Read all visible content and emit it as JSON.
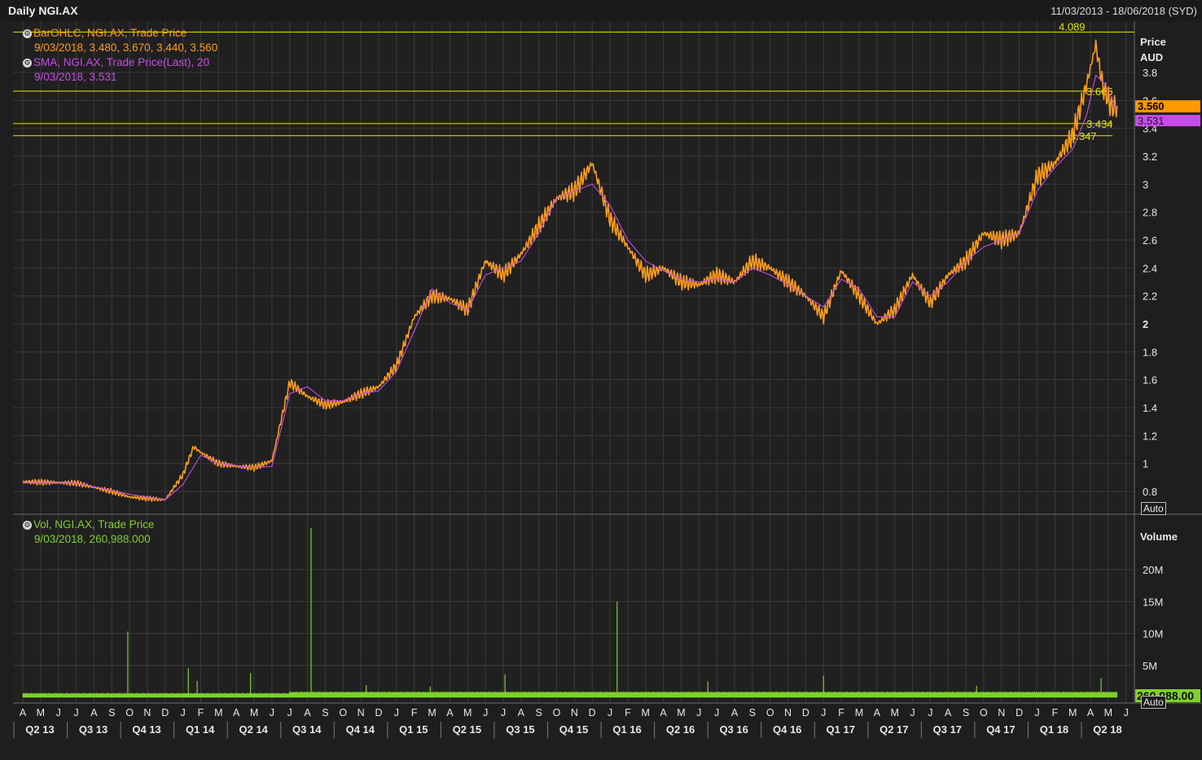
{
  "header": {
    "title": "Daily NGI.AX",
    "date_range": "11/03/2013 - 18/06/2018 (SYD)"
  },
  "legend": {
    "ohlc_label": "BarOHLC, NGI.AX, Trade Price",
    "ohlc_values": "9/03/2018, 3.480, 3.670, 3.440, 3.560",
    "sma_label": "SMA, NGI.AX, Trade Price(Last),  20",
    "sma_values": "9/03/2018, 3.531",
    "vol_label": "Vol, NGI.AX, Trade Price",
    "vol_values": "9/03/2018, 260,988.000"
  },
  "axes": {
    "price_title": "Price",
    "price_unit": "AUD",
    "volume_title": "Volume",
    "auto_label": "Auto"
  },
  "colors": {
    "price": "#ff9d1a",
    "sma": "#c84ce8",
    "volume": "#7fd12a",
    "hline": "#e6e600",
    "grid": "#3a3a3a"
  },
  "chart_data": [
    {
      "type": "line",
      "ylim": [
        0.7,
        4.1
      ],
      "y_ticks": [
        0.8,
        1,
        1.2,
        1.4,
        1.6,
        1.8,
        2,
        2.2,
        2.4,
        2.6,
        2.8,
        3,
        3.2,
        3.4,
        3.6,
        3.8
      ],
      "months": [
        "A",
        "M",
        "J",
        "J",
        "A",
        "S",
        "O",
        "N",
        "D",
        "J",
        "F",
        "M",
        "A",
        "M",
        "J",
        "J",
        "A",
        "S",
        "O",
        "N",
        "D",
        "J",
        "F",
        "M",
        "A",
        "M",
        "J",
        "J",
        "A",
        "S",
        "O",
        "N",
        "D",
        "J",
        "F",
        "M",
        "A",
        "M",
        "J",
        "J",
        "A",
        "S",
        "O",
        "N",
        "D",
        "J",
        "F",
        "M",
        "A",
        "M",
        "J",
        "J",
        "A",
        "S",
        "O",
        "N",
        "D",
        "J",
        "F",
        "M",
        "A",
        "M",
        "J"
      ],
      "quarters": [
        "Q2 13",
        "Q3 13",
        "Q4 13",
        "Q1 14",
        "Q2 14",
        "Q3 14",
        "Q4 14",
        "Q1 15",
        "Q2 15",
        "Q3 15",
        "Q4 15",
        "Q1 16",
        "Q2 16",
        "Q3 16",
        "Q4 16",
        "Q1 17",
        "Q2 17",
        "Q3 17",
        "Q4 17",
        "Q1 18",
        "Q2 18"
      ],
      "series": [
        {
          "values": [
            [
              0,
              0.87
            ],
            [
              3,
              0.86
            ],
            [
              5,
              0.8
            ],
            [
              6,
              0.76
            ],
            [
              7,
              0.75
            ],
            [
              8,
              0.74
            ],
            [
              9,
              0.92
            ],
            [
              9.6,
              1.12
            ],
            [
              10,
              1.08
            ],
            [
              11,
              1.0
            ],
            [
              12,
              0.98
            ],
            [
              13,
              0.97
            ],
            [
              14,
              1.02
            ],
            [
              15,
              1.58
            ],
            [
              16,
              1.48
            ],
            [
              17,
              1.42
            ],
            [
              18,
              1.44
            ],
            [
              19,
              1.5
            ],
            [
              20,
              1.55
            ],
            [
              21,
              1.7
            ],
            [
              22,
              2.05
            ],
            [
              23,
              2.2
            ],
            [
              24,
              2.18
            ],
            [
              25,
              2.1
            ],
            [
              26,
              2.45
            ],
            [
              27,
              2.35
            ],
            [
              28,
              2.5
            ],
            [
              29,
              2.7
            ],
            [
              30,
              2.9
            ],
            [
              31,
              2.95
            ],
            [
              32,
              3.15
            ],
            [
              33,
              2.75
            ],
            [
              34,
              2.55
            ],
            [
              35,
              2.35
            ],
            [
              36,
              2.4
            ],
            [
              37,
              2.3
            ],
            [
              38,
              2.28
            ],
            [
              39,
              2.35
            ],
            [
              40,
              2.3
            ],
            [
              41,
              2.45
            ],
            [
              42,
              2.4
            ],
            [
              43,
              2.3
            ],
            [
              44,
              2.2
            ],
            [
              45,
              2.05
            ],
            [
              46,
              2.38
            ],
            [
              47,
              2.2
            ],
            [
              48,
              2.0
            ],
            [
              49,
              2.1
            ],
            [
              50,
              2.35
            ],
            [
              51,
              2.15
            ],
            [
              52,
              2.35
            ],
            [
              53,
              2.45
            ],
            [
              54,
              2.65
            ],
            [
              55,
              2.6
            ],
            [
              56,
              2.65
            ],
            [
              57,
              3.05
            ],
            [
              58,
              3.15
            ],
            [
              59,
              3.35
            ],
            [
              59.8,
              3.72
            ],
            [
              60.3,
              4.0
            ],
            [
              60.7,
              3.7
            ],
            [
              61.2,
              3.55
            ],
            [
              61.5,
              3.56
            ]
          ]
        },
        {
          "values": [
            [
              0,
              0.86
            ],
            [
              3,
              0.86
            ],
            [
              6,
              0.78
            ],
            [
              8,
              0.74
            ],
            [
              9,
              0.85
            ],
            [
              10,
              1.06
            ],
            [
              11,
              1.0
            ],
            [
              13,
              0.97
            ],
            [
              14,
              0.98
            ],
            [
              15,
              1.5
            ],
            [
              16,
              1.55
            ],
            [
              17,
              1.45
            ],
            [
              18,
              1.45
            ],
            [
              19,
              1.5
            ],
            [
              20,
              1.52
            ],
            [
              21,
              1.66
            ],
            [
              22,
              1.95
            ],
            [
              23,
              2.25
            ],
            [
              24,
              2.15
            ],
            [
              25,
              2.1
            ],
            [
              26,
              2.35
            ],
            [
              27,
              2.4
            ],
            [
              28,
              2.45
            ],
            [
              29,
              2.65
            ],
            [
              30,
              2.9
            ],
            [
              31,
              2.95
            ],
            [
              32,
              3.0
            ],
            [
              33,
              2.85
            ],
            [
              34,
              2.6
            ],
            [
              35,
              2.45
            ],
            [
              36,
              2.38
            ],
            [
              37,
              2.32
            ],
            [
              38,
              2.3
            ],
            [
              39,
              2.32
            ],
            [
              40,
              2.3
            ],
            [
              41,
              2.4
            ],
            [
              42,
              2.35
            ],
            [
              43,
              2.28
            ],
            [
              44,
              2.2
            ],
            [
              45,
              2.12
            ],
            [
              46,
              2.32
            ],
            [
              47,
              2.25
            ],
            [
              48,
              2.05
            ],
            [
              49,
              2.05
            ],
            [
              50,
              2.3
            ],
            [
              51,
              2.2
            ],
            [
              52,
              2.3
            ],
            [
              53,
              2.45
            ],
            [
              54,
              2.55
            ],
            [
              55,
              2.6
            ],
            [
              56,
              2.65
            ],
            [
              57,
              2.95
            ],
            [
              58,
              3.12
            ],
            [
              59,
              3.25
            ],
            [
              59.8,
              3.5
            ],
            [
              60.3,
              3.78
            ],
            [
              60.8,
              3.72
            ],
            [
              61.5,
              3.53
            ]
          ]
        }
      ],
      "hlines": [
        {
          "value": 4.089,
          "label": "4.089"
        },
        {
          "value": 3.666,
          "label": "3.666"
        },
        {
          "value": 3.434,
          "label": "3.434"
        },
        {
          "value": 3.347,
          "label": "3.347"
        }
      ],
      "last_labels": {
        "price": "3.560",
        "sma": "3.531"
      }
    },
    {
      "type": "bar",
      "ylim": [
        0,
        26000000
      ],
      "y_ticks": [
        {
          "value": 5000000,
          "label": "5M"
        },
        {
          "value": 10000000,
          "label": "10M"
        },
        {
          "value": 15000000,
          "label": "15M"
        },
        {
          "value": 20000000,
          "label": "20M"
        }
      ],
      "spikes": [
        {
          "x": 5.9,
          "value": 10300000
        },
        {
          "x": 9.3,
          "value": 4600000
        },
        {
          "x": 9.8,
          "value": 2600000
        },
        {
          "x": 12.8,
          "value": 3800000
        },
        {
          "x": 16.2,
          "value": 26500000
        },
        {
          "x": 19.3,
          "value": 1900000
        },
        {
          "x": 22.9,
          "value": 1700000
        },
        {
          "x": 27.1,
          "value": 3600000
        },
        {
          "x": 33.4,
          "value": 15000000
        },
        {
          "x": 38.5,
          "value": 2500000
        },
        {
          "x": 45.0,
          "value": 3400000
        },
        {
          "x": 53.6,
          "value": 1800000
        },
        {
          "x": 60.6,
          "value": 3000000
        }
      ],
      "last_label": "260,988.00"
    }
  ]
}
